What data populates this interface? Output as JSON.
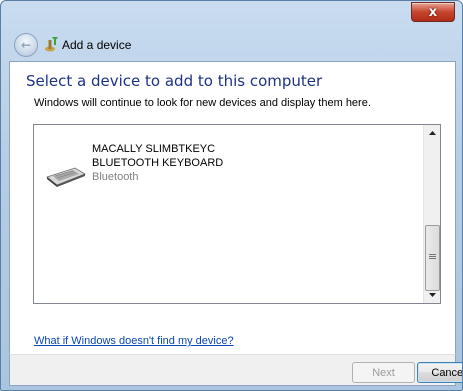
{
  "window": {
    "close_glyph": "x"
  },
  "nav": {
    "back_glyph": "←",
    "title": "Add a device"
  },
  "main": {
    "heading": "Select a device to add to this computer",
    "description": "Windows will continue to look for new devices and display them here.",
    "devices": [
      {
        "name_line1": "MACALLY SLIMBTKEYC",
        "name_line2": "BLUETOOTH KEYBOARD",
        "type": "Bluetooth",
        "icon": "keyboard-icon"
      }
    ],
    "help_link": "What if Windows doesn't find my device?"
  },
  "footer": {
    "next_label": "Next",
    "cancel_label": "Cancel"
  },
  "colors": {
    "heading": "#1e3287",
    "link": "#0a46b4",
    "close_button": "#c7452f"
  }
}
